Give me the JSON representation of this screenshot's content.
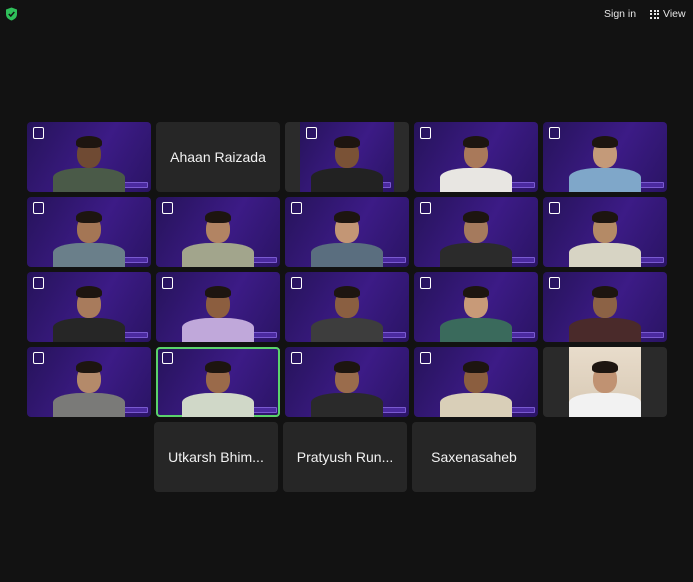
{
  "toolbar": {
    "sign_in_label": "Sign in",
    "view_label": "View"
  },
  "gallery": {
    "rows": [
      [
        {
          "type": "video",
          "style": "purple",
          "shirt": "#4a5a48",
          "skin": "#6f4a33"
        },
        {
          "type": "name",
          "name": "Ahaan Raizada"
        },
        {
          "type": "video",
          "style": "dark-sides",
          "shirt": "#222222",
          "skin": "#7a5236"
        },
        {
          "type": "video",
          "style": "purple",
          "shirt": "#e8e6e2",
          "skin": "#a9795a"
        },
        {
          "type": "video",
          "style": "purple",
          "shirt": "#7fa7c9",
          "skin": "#c49a79"
        }
      ],
      [
        {
          "type": "video",
          "style": "purple",
          "shirt": "#6a7f8a",
          "skin": "#a47655"
        },
        {
          "type": "video",
          "style": "purple",
          "shirt": "#a2a58c",
          "skin": "#b28463"
        },
        {
          "type": "video",
          "style": "purple",
          "shirt": "#5a6e7f",
          "skin": "#c39675"
        },
        {
          "type": "video",
          "style": "purple",
          "shirt": "#2b2b2b",
          "skin": "#a57a5d"
        },
        {
          "type": "video",
          "style": "purple",
          "shirt": "#d7d4c4",
          "skin": "#b48a66"
        }
      ],
      [
        {
          "type": "video",
          "style": "purple",
          "shirt": "#262626",
          "skin": "#a87b5c"
        },
        {
          "type": "video",
          "style": "purple",
          "shirt": "#c0a8da",
          "skin": "#8c5e3f"
        },
        {
          "type": "video",
          "style": "purple",
          "shirt": "#3d3d3d",
          "skin": "#8a5f41"
        },
        {
          "type": "video",
          "style": "purple",
          "shirt": "#3a6a5c",
          "skin": "#c89a78"
        },
        {
          "type": "video",
          "style": "purple",
          "shirt": "#4a2a2a",
          "skin": "#8c6245"
        }
      ],
      [
        {
          "type": "video",
          "style": "purple",
          "shirt": "#7a7a78",
          "skin": "#b48a6a"
        },
        {
          "type": "video",
          "style": "purple",
          "shirt": "#d0d8c8",
          "skin": "#9a6a4a",
          "active": true
        },
        {
          "type": "video",
          "style": "purple",
          "shirt": "#2a2a2a",
          "skin": "#9a6c4c"
        },
        {
          "type": "video",
          "style": "purple",
          "shirt": "#d9cfb8",
          "skin": "#8b5e3f"
        },
        {
          "type": "video",
          "style": "plain",
          "shirt": "#f2f2f2",
          "skin": "#c09272"
        }
      ],
      [
        {
          "type": "name",
          "name": "Utkarsh Bhim..."
        },
        {
          "type": "name",
          "name": "Pratyush Run..."
        },
        {
          "type": "name",
          "name": "Saxenasaheb"
        }
      ]
    ]
  }
}
